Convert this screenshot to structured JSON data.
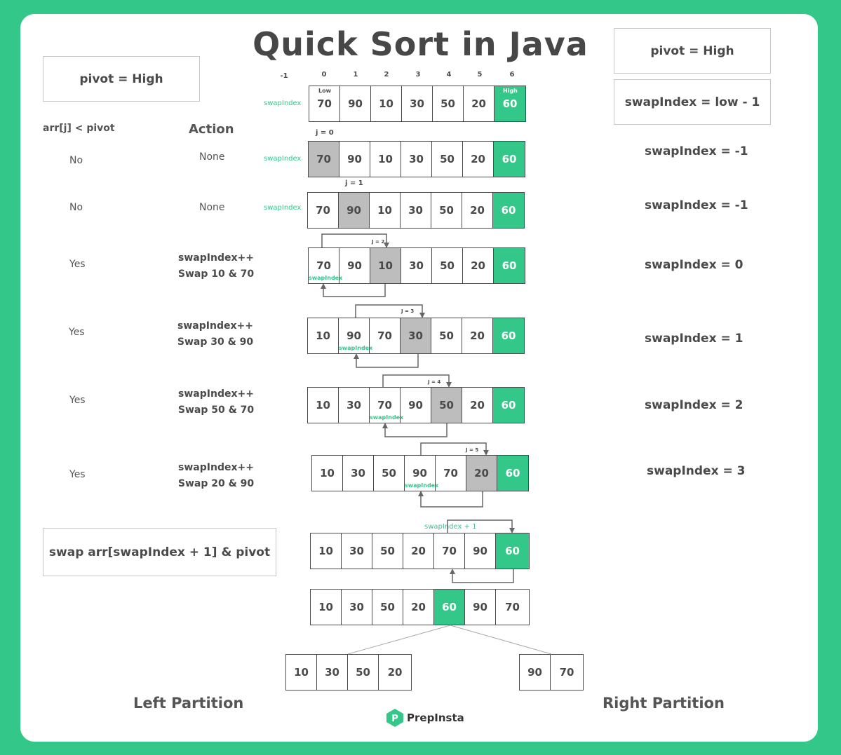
{
  "title": "Quick Sort in Java",
  "left_pivot_label": "pivot = High",
  "right_pivot_label": "pivot = High",
  "swapindex_init_label": "swapIndex = low - 1",
  "col_condition_header": "arr[j] < pivot",
  "col_action_header": "Action",
  "swap_final_label": "swap arr[swapIndex + 1] & pivot",
  "indices": [
    "-1",
    "0",
    "1",
    "2",
    "3",
    "4",
    "5",
    "6"
  ],
  "low_label": "Low",
  "high_label": "High",
  "swapindex_tag": "swapIndex",
  "swapindex_plus_one": "swapIndex + 1",
  "initial_array": [
    "70",
    "90",
    "10",
    "30",
    "50",
    "20",
    "60"
  ],
  "steps": [
    {
      "j": "j = 0",
      "cond": "No",
      "action1": "None",
      "action2": "",
      "swap_state": "swapIndex = -1",
      "values": [
        "70",
        "90",
        "10",
        "30",
        "50",
        "20",
        "60"
      ]
    },
    {
      "j": "j = 1",
      "cond": "No",
      "action1": "None",
      "action2": "",
      "swap_state": "swapIndex = -1",
      "values": [
        "70",
        "90",
        "10",
        "30",
        "50",
        "20",
        "60"
      ]
    },
    {
      "j": "J = 2",
      "cond": "Yes",
      "action1": "swapIndex++",
      "action2": "Swap 10 & 70",
      "swap_state": "swapIndex = 0",
      "values": [
        "70",
        "90",
        "10",
        "30",
        "50",
        "20",
        "60"
      ]
    },
    {
      "j": "J = 3",
      "cond": "Yes",
      "action1": "swapIndex++",
      "action2": "Swap 30 & 90",
      "swap_state": "swapIndex = 1",
      "values": [
        "10",
        "90",
        "70",
        "30",
        "50",
        "20",
        "60"
      ]
    },
    {
      "j": "J = 4",
      "cond": "Yes",
      "action1": "swapIndex++",
      "action2": "Swap 50 & 70",
      "swap_state": "swapIndex = 2",
      "values": [
        "10",
        "30",
        "70",
        "90",
        "50",
        "20",
        "60"
      ]
    },
    {
      "j": "J = 5",
      "cond": "Yes",
      "action1": "swapIndex++",
      "action2": "Swap 20 & 90",
      "swap_state": "swapIndex = 3",
      "values": [
        "10",
        "30",
        "50",
        "90",
        "70",
        "20",
        "60"
      ]
    }
  ],
  "before_pivot_swap": [
    "10",
    "30",
    "50",
    "20",
    "70",
    "90",
    "60"
  ],
  "after_pivot_swap": [
    "10",
    "30",
    "50",
    "20",
    "60",
    "90",
    "70"
  ],
  "left_partition": [
    "10",
    "30",
    "50",
    "20"
  ],
  "right_partition": [
    "90",
    "70"
  ],
  "left_partition_label": "Left Partition",
  "right_partition_label": "Right Partition",
  "brand": "PrepInsta",
  "colors": {
    "background": "#33c88a",
    "pivot": "#33c88a",
    "current": "#bdbdbd",
    "text": "#4a4a4a"
  }
}
